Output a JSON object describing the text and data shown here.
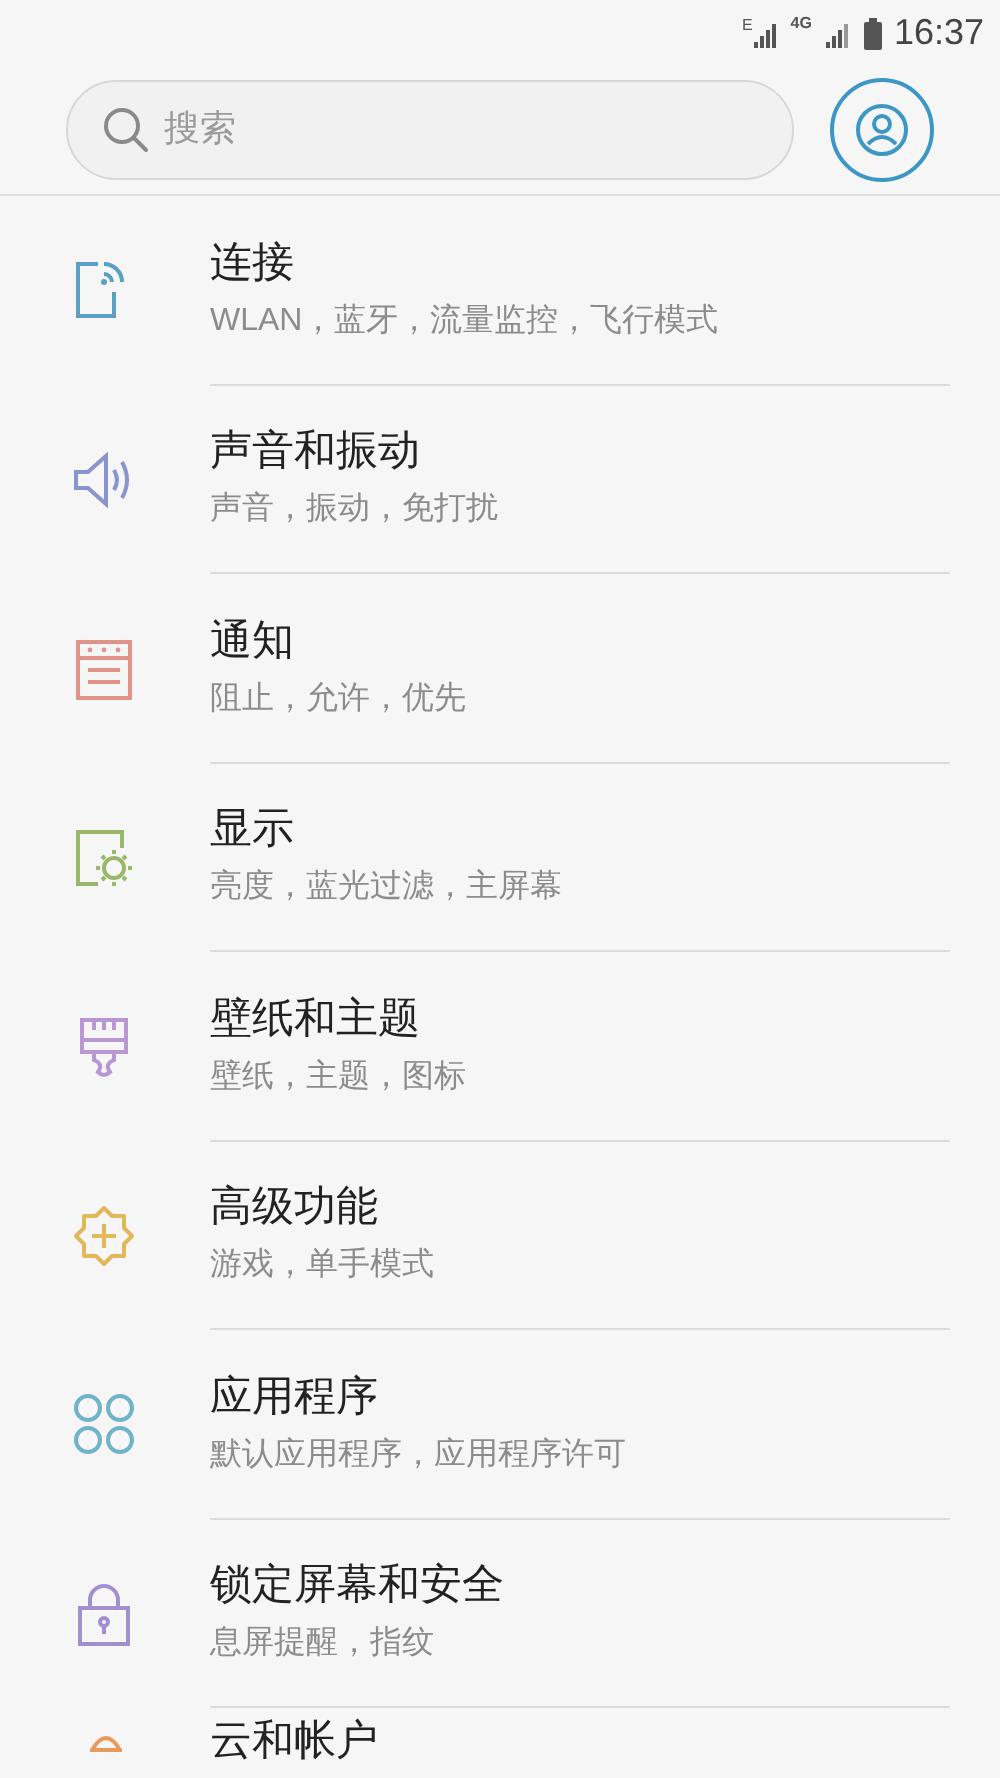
{
  "status_bar": {
    "network_1": "E",
    "network_2": "4G",
    "time": "16:37"
  },
  "search": {
    "placeholder": "搜索"
  },
  "items": [
    {
      "title": "连接",
      "subtitle": "WLAN，蓝牙，流量监控，飞行模式",
      "kind": "connections",
      "color": "#5a9fc4"
    },
    {
      "title": "声音和振动",
      "subtitle": "声音，振动，免打扰",
      "kind": "sound",
      "color": "#8a95d0"
    },
    {
      "title": "通知",
      "subtitle": "阻止，允许，优先",
      "kind": "notifications",
      "color": "#e0938a"
    },
    {
      "title": "显示",
      "subtitle": "亮度，蓝光过滤，主屏幕",
      "kind": "display",
      "color": "#9ab86a"
    },
    {
      "title": "壁纸和主题",
      "subtitle": "壁纸，主题，图标",
      "kind": "wallpaper",
      "color": "#b996d4"
    },
    {
      "title": "高级功能",
      "subtitle": "游戏，单手模式",
      "kind": "advanced",
      "color": "#e2b95a"
    },
    {
      "title": "应用程序",
      "subtitle": "默认应用程序，应用程序许可",
      "kind": "apps",
      "color": "#6fb4c8"
    },
    {
      "title": "锁定屏幕和安全",
      "subtitle": "息屏提醒，指纹",
      "kind": "lock",
      "color": "#a28fd0"
    },
    {
      "title": "云和帐户",
      "kind": "account",
      "color": "#e79a5a"
    }
  ]
}
